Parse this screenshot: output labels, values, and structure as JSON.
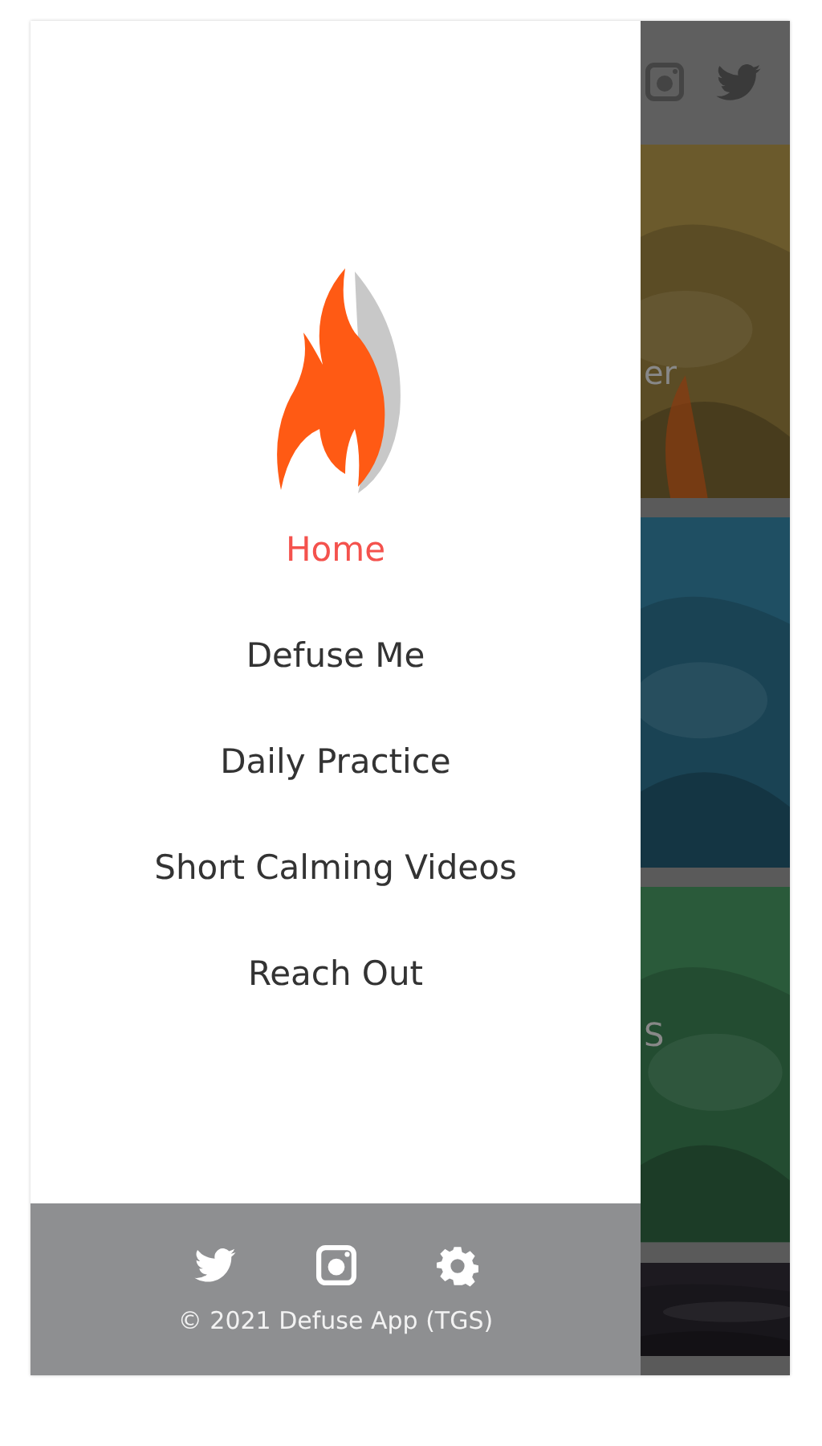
{
  "drawer": {
    "menu": [
      {
        "label": "Home",
        "selected": true
      },
      {
        "label": "Defuse Me",
        "selected": false
      },
      {
        "label": "Daily Practice",
        "selected": false
      },
      {
        "label": "Short Calming Videos",
        "selected": false
      },
      {
        "label": "Reach Out",
        "selected": false
      }
    ],
    "footer": {
      "copyright": "© 2021 Defuse App (TGS)"
    }
  },
  "background": {
    "cards": [
      {
        "kind": "picture",
        "caption": "er"
      },
      {
        "kind": "picture"
      },
      {
        "kind": "picture",
        "caption": "S"
      },
      {
        "kind": "picture"
      }
    ]
  }
}
